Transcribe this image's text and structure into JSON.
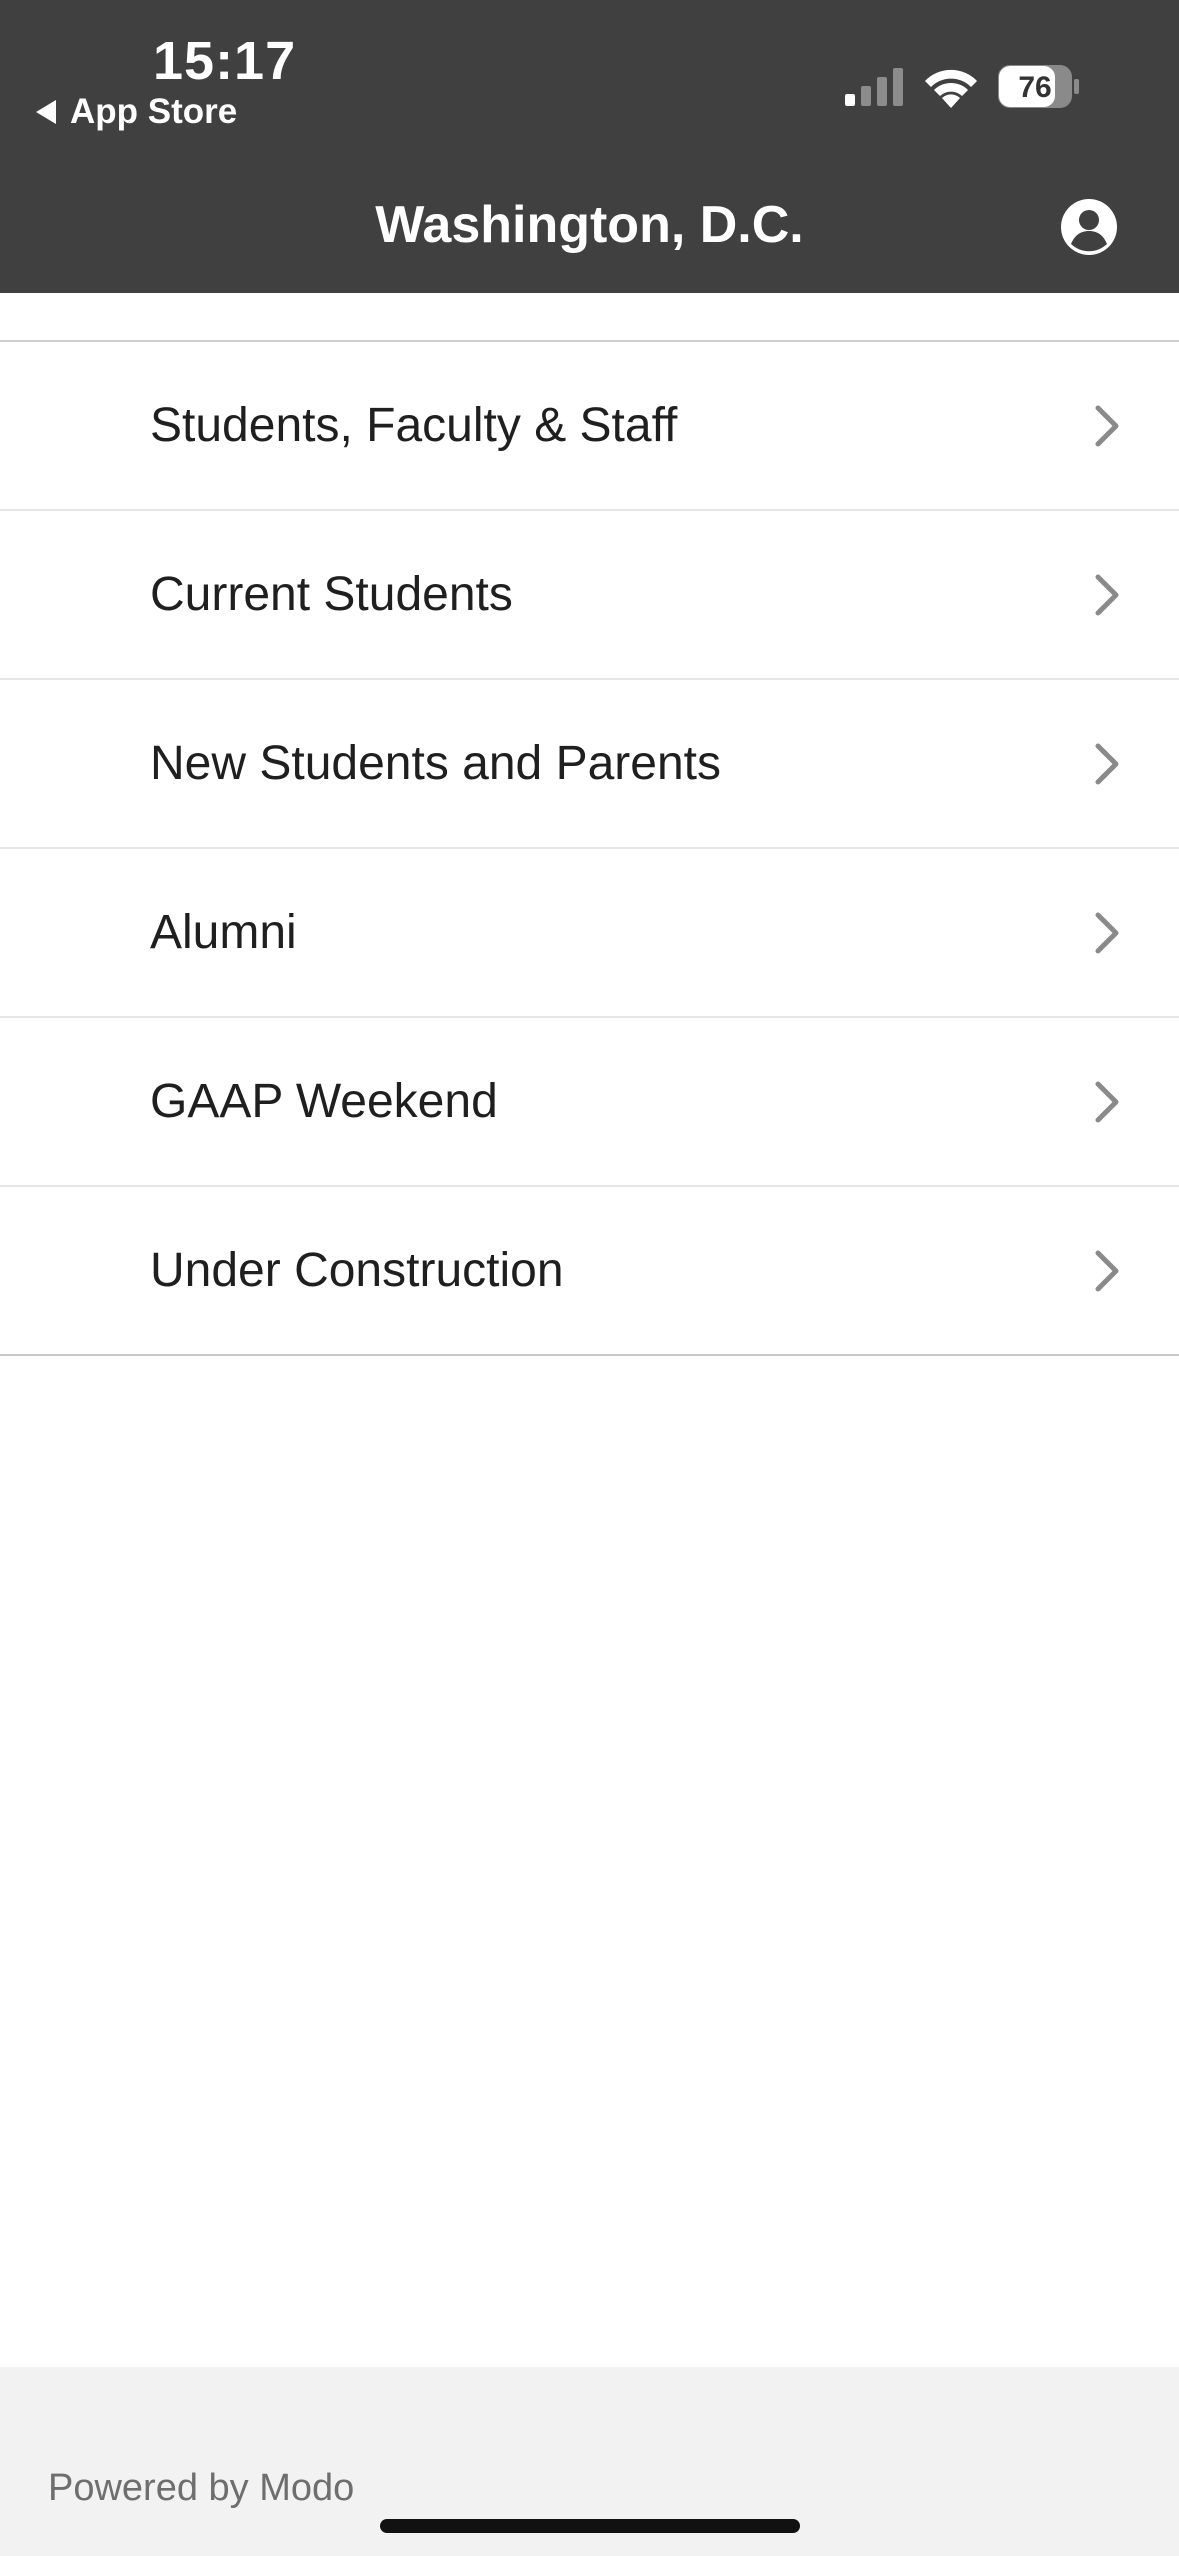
{
  "status_bar": {
    "time": "15:17",
    "back_app_label": "App Store",
    "battery_level": "76",
    "signal_icon": "cellular-signal-icon",
    "wifi_icon": "wifi-icon",
    "battery_icon": "battery-icon"
  },
  "nav": {
    "title": "Washington, D.C.",
    "account_icon": "account-circle-icon"
  },
  "menu": {
    "items": [
      {
        "label": "Students, Faculty & Staff"
      },
      {
        "label": "Current Students"
      },
      {
        "label": "New Students and Parents"
      },
      {
        "label": "Alumni"
      },
      {
        "label": "GAAP Weekend"
      },
      {
        "label": "Under Construction"
      }
    ],
    "chevron_icon": "chevron-right-icon"
  },
  "footer": {
    "text": "Powered by Modo"
  },
  "colors": {
    "header_bg": "#404040",
    "footer_bg": "#f2f2f2",
    "text": "#1f1f1f",
    "chevron": "#8a8a8a"
  }
}
